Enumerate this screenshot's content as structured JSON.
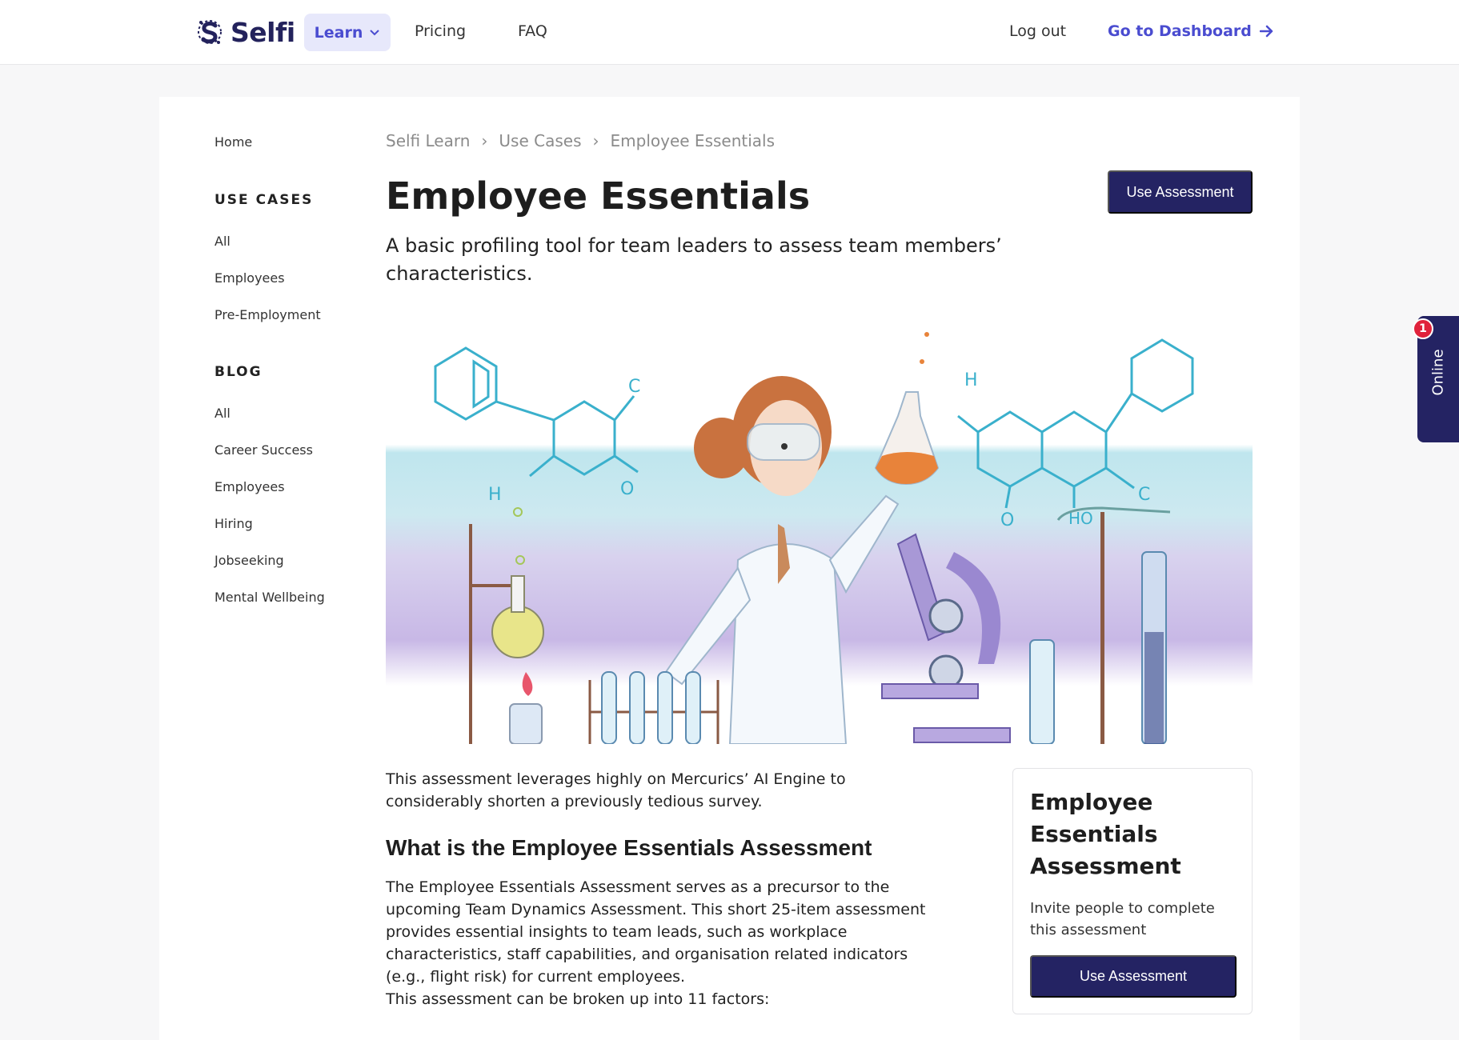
{
  "nav": {
    "logo_text": "Selfi",
    "learn_label": "Learn",
    "pricing_label": "Pricing",
    "faq_label": "FAQ",
    "logout_label": "Log out",
    "dashboard_label": "Go to Dashboard"
  },
  "sidebar": {
    "home": "Home",
    "use_cases_heading": "USE CASES",
    "use_cases": [
      "All",
      "Employees",
      "Pre-Employment"
    ],
    "blog_heading": "BLOG",
    "blog": [
      "All",
      "Career Success",
      "Employees",
      "Hiring",
      "Jobseeking",
      "Mental Wellbeing"
    ]
  },
  "breadcrumb": [
    "Selfi Learn",
    "Use Cases",
    "Employee Essentials"
  ],
  "page": {
    "title": "Employee Essentials",
    "subtitle": "A basic profiling tool for team leaders to assess team members’ characteristics.",
    "use_assessment_label": "Use Assessment",
    "intro": "This assessment leverages highly on Mercurics’ AI Engine to considerably shorten a previously tedious survey.",
    "section_heading": "What is the Employee Essentials Assessment",
    "section_body": "The Employee Essentials Assessment serves as a precursor to the upcoming Team Dynamics Assessment. This short 25-item assessment provides essential insights to team leads, such as workplace characteristics, staff capabilities, and organisation related indicators (e.g., flight risk) for current employees.",
    "factors_text": "This assessment can be broken up into 11 factors:"
  },
  "side_card": {
    "title": "Employee Essentials Assessment",
    "description": "Invite people to complete this assessment",
    "button_label": "Use Assessment"
  },
  "online_widget": {
    "label": "Online",
    "badge": "1"
  },
  "hero_labels": {
    "h_left": "H",
    "c_left": "C",
    "o_left": "O",
    "h_right": "H",
    "o_right": "O",
    "ho_right": "HO",
    "c_right": "C"
  },
  "colors": {
    "primary_dark": "#242363",
    "accent": "#4a4cd0",
    "learn_bg": "#e7e8fb",
    "badge_red": "#e0223b"
  }
}
